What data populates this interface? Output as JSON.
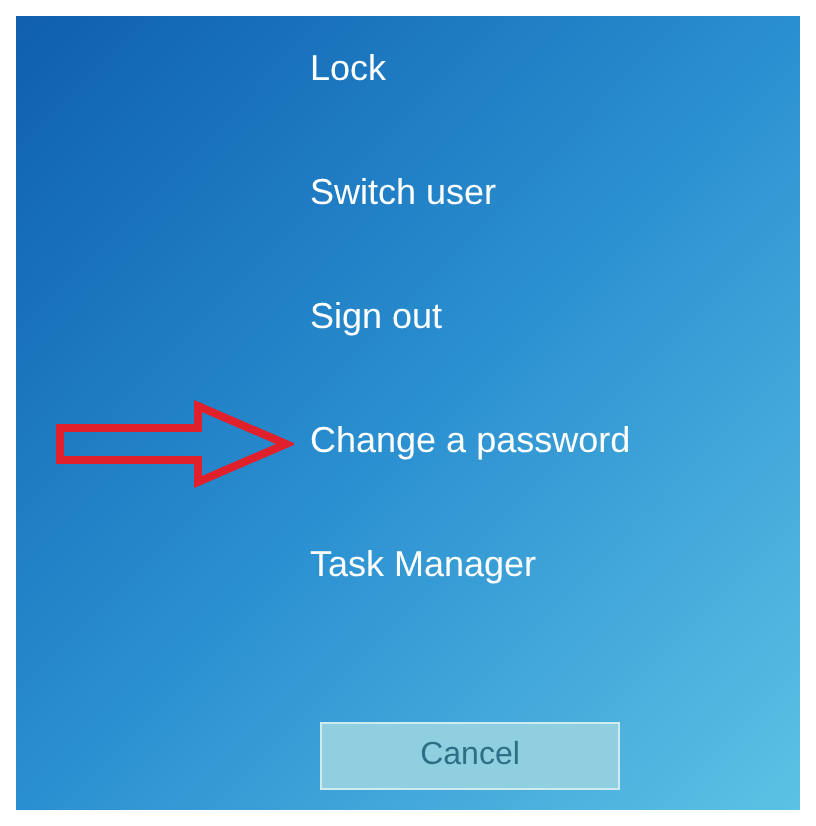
{
  "menu": [
    {
      "label": "Lock",
      "highlighted": false
    },
    {
      "label": "Switch user",
      "highlighted": false
    },
    {
      "label": "Sign out",
      "highlighted": false
    },
    {
      "label": "Change a password",
      "highlighted": true
    },
    {
      "label": "Task Manager",
      "highlighted": false
    }
  ],
  "cancel_button": {
    "label": "Cancel"
  }
}
